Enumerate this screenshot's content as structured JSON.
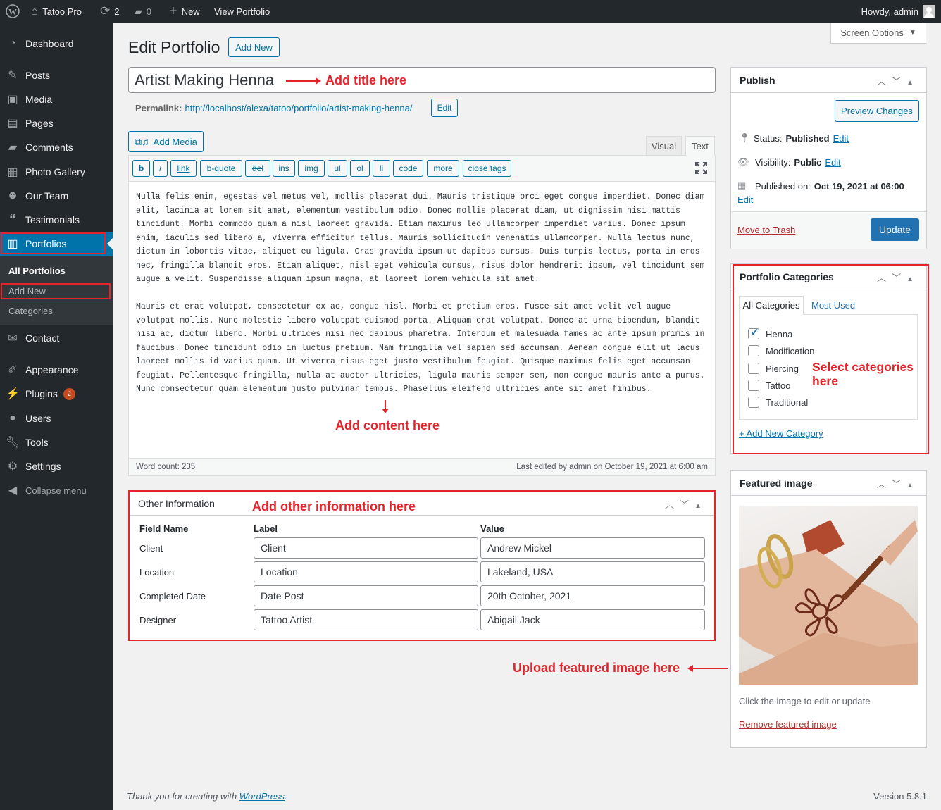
{
  "adminbar": {
    "site_name": "Tatoo Pro",
    "updates_count": "2",
    "comments_count": "0",
    "new_label": "New",
    "view_label": "View Portfolio",
    "howdy": "Howdy, admin"
  },
  "sidebar": {
    "items": [
      {
        "label": "Dashboard",
        "icon": "dashboard-icon"
      },
      {
        "label": "Posts",
        "icon": "pin-icon"
      },
      {
        "label": "Media",
        "icon": "media-icon"
      },
      {
        "label": "Pages",
        "icon": "pages-icon"
      },
      {
        "label": "Comments",
        "icon": "comment-icon"
      },
      {
        "label": "Photo Gallery",
        "icon": "gallery-icon"
      },
      {
        "label": "Our Team",
        "icon": "team-icon"
      },
      {
        "label": "Testimonials",
        "icon": "quote-icon"
      },
      {
        "label": "Portfolios",
        "icon": "portfolio-icon"
      },
      {
        "label": "Contact",
        "icon": "mail-icon"
      },
      {
        "label": "Appearance",
        "icon": "brush-icon"
      },
      {
        "label": "Plugins",
        "icon": "plugin-icon",
        "badge": "2"
      },
      {
        "label": "Users",
        "icon": "user-icon"
      },
      {
        "label": "Tools",
        "icon": "wrench-icon"
      },
      {
        "label": "Settings",
        "icon": "settings-icon"
      },
      {
        "label": "Collapse menu",
        "icon": "collapse-icon"
      }
    ],
    "submenu": [
      "All Portfolios",
      "Add New",
      "Categories"
    ]
  },
  "screen_options": "Screen Options",
  "page_title": "Edit Portfolio",
  "add_new": "Add New",
  "post_title": "Artist Making Henna",
  "annotations": {
    "title": "Add title here",
    "content": "Add content here",
    "other": "Add other information here",
    "categories_1": "Select categories",
    "categories_2": "here",
    "featured": "Upload featured image here"
  },
  "permalink": {
    "label": "Permalink:",
    "base": "http://localhost/alexa/tatoo/portfolio/",
    "slug": "artist-making-henna",
    "trail": "/",
    "edit": "Edit"
  },
  "editor": {
    "add_media": "Add Media",
    "tab_visual": "Visual",
    "tab_text": "Text",
    "quicktags": [
      "b",
      "i",
      "link",
      "b-quote",
      "del",
      "ins",
      "img",
      "ul",
      "ol",
      "li",
      "code",
      "more",
      "close tags"
    ],
    "content_p1": "Nulla felis enim, egestas vel metus vel, mollis placerat dui. Mauris tristique orci eget congue imperdiet. Donec diam elit, lacinia at lorem sit amet, elementum vestibulum odio. Donec mollis placerat diam, ut dignissim nisi mattis tincidunt. Morbi commodo quam a nisl laoreet gravida. Etiam maximus leo ullamcorper imperdiet varius. Donec ipsum enim, iaculis sed libero a, viverra efficitur tellus. Mauris sollicitudin venenatis ullamcorper. Nulla lectus nunc, dictum in lobortis vitae, aliquet eu ligula. Cras gravida ipsum ut dapibus cursus. Duis turpis lectus, porta in eros nec, fringilla blandit eros. Etiam aliquet, nisl eget vehicula cursus, risus dolor hendrerit ipsum, vel tincidunt sem augue a velit. Suspendisse aliquam ipsum magna, at laoreet lorem vehicula sit amet.",
    "content_p2": "Mauris et erat volutpat, consectetur ex ac, congue nisl. Morbi et pretium eros. Fusce sit amet velit vel augue volutpat mollis. Nunc molestie libero volutpat euismod porta. Aliquam erat volutpat. Donec at urna bibendum, blandit nisi ac, dictum libero. Morbi ultrices nisi nec dapibus pharetra. Interdum et malesuada fames ac ante ipsum primis in faucibus. Donec tincidunt odio in luctus pretium. Nam fringilla vel sapien sed accumsan. Aenean congue elit ut lacus laoreet mollis id varius quam. Ut viverra risus eget justo vestibulum feugiat. Quisque maximus felis eget accumsan feugiat. Pellentesque fringilla, nulla at auctor ultricies, ligula mauris semper sem, non congue mauris ante a purus. Nunc consectetur quam elementum justo pulvinar tempus. Phasellus eleifend ultricies ante sit amet finibus.",
    "word_count": "Word count: 235",
    "last_edited": "Last edited by admin on October 19, 2021 at 6:00 am"
  },
  "other_info": {
    "title": "Other Information",
    "headers": [
      "Field Name",
      "Label",
      "Value"
    ],
    "rows": [
      {
        "field": "Client",
        "label": "Client",
        "value": "Andrew Mickel"
      },
      {
        "field": "Location",
        "label": "Location",
        "value": "Lakeland, USA"
      },
      {
        "field": "Completed Date",
        "label": "Date Post",
        "value": "20th October, 2021"
      },
      {
        "field": "Designer",
        "label": "Tattoo Artist",
        "value": "Abigail Jack"
      }
    ]
  },
  "publish": {
    "title": "Publish",
    "preview": "Preview Changes",
    "status_label": "Status:",
    "status": "Published",
    "visibility_label": "Visibility:",
    "visibility": "Public",
    "published_label": "Published on:",
    "published": "Oct 19, 2021 at 06:00",
    "edit": "Edit",
    "trash": "Move to Trash",
    "update": "Update"
  },
  "categories": {
    "title": "Portfolio Categories",
    "tab_all": "All Categories",
    "tab_used": "Most Used",
    "items": [
      {
        "name": "Henna",
        "checked": true
      },
      {
        "name": "Modification",
        "checked": false
      },
      {
        "name": "Piercing",
        "checked": false
      },
      {
        "name": "Tattoo",
        "checked": false
      },
      {
        "name": "Traditional",
        "checked": false
      }
    ],
    "add_new": "+ Add New Category"
  },
  "featured": {
    "title": "Featured image",
    "hint": "Click the image to edit or update",
    "remove": "Remove featured image"
  },
  "footer": {
    "thanks": "Thank you for creating with ",
    "wp": "WordPress",
    "dot": ".",
    "version": "Version 5.8.1"
  },
  "colors": {
    "accent": "#0073aa",
    "annotation": "#e3242b",
    "sidebar": "#23282d"
  }
}
